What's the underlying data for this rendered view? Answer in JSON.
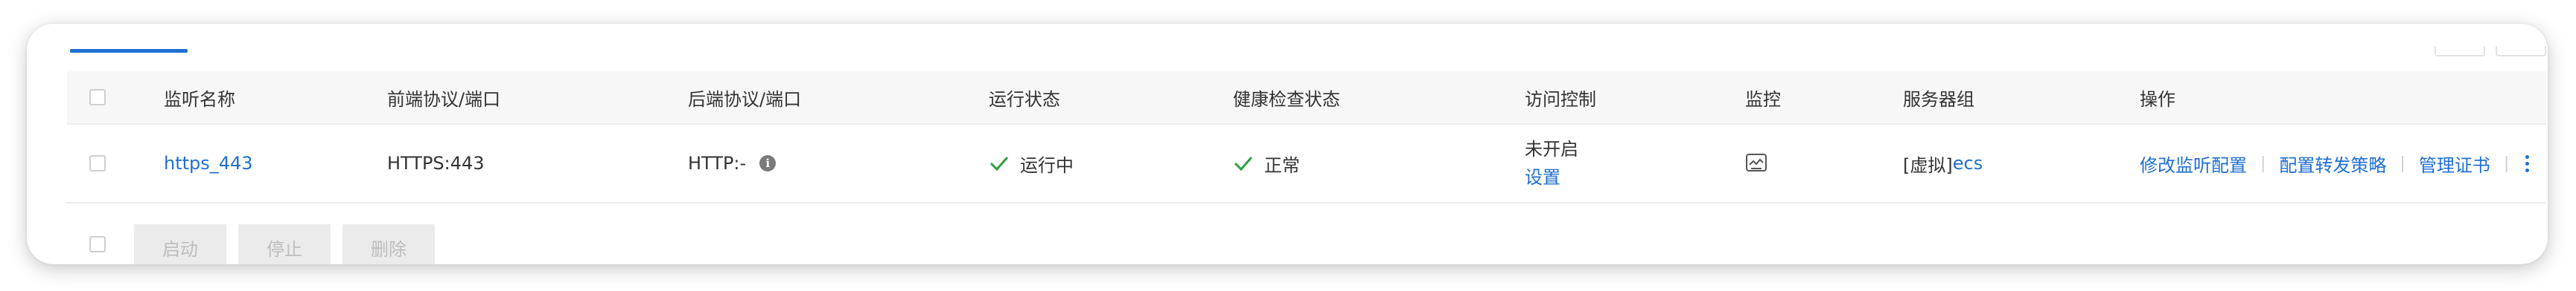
{
  "columns": {
    "name": "监听名称",
    "frontend": "前端协议/端口",
    "backend": "后端协议/端口",
    "run_status": "运行状态",
    "health_status": "健康检查状态",
    "access_control": "访问控制",
    "monitor": "监控",
    "server_group": "服务器组",
    "actions": "操作"
  },
  "row": {
    "name": "https_443",
    "frontend": "HTTPS:443",
    "backend": "HTTP:-",
    "run_status": "运行中",
    "health_status": "正常",
    "access_control_status": "未开启",
    "access_control_link": "设置",
    "server_group_prefix": "[虚拟]",
    "server_group_name": "ecs",
    "actions": [
      "修改监听配置",
      "配置转发策略",
      "管理证书"
    ]
  },
  "footer": {
    "start": "启动",
    "stop": "停止",
    "delete": "删除"
  },
  "colors": {
    "link": "#1f6fd1",
    "success": "#2ea043",
    "disabled_bg": "#ebebeb",
    "disabled_text": "#bdbdbd"
  },
  "icons": [
    "info-icon",
    "check-icon",
    "monitor-icon",
    "more-vertical-icon"
  ]
}
